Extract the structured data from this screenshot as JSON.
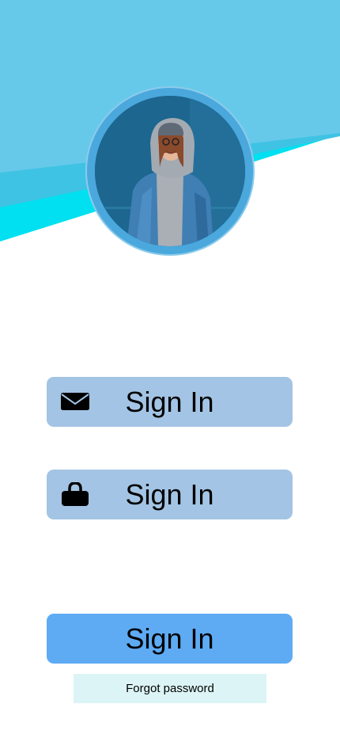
{
  "colors": {
    "header_primary": "#67c9ea",
    "header_accent": "#00e0f0",
    "avatar_ring": "#4aa8dd",
    "field_background": "#a3c4e4",
    "submit_background": "#5eabf4",
    "forgot_background": "#dcf4f5"
  },
  "avatar": {
    "description": "profile-photo"
  },
  "email_field": {
    "icon": "envelope-icon",
    "label": "Sign In"
  },
  "password_field": {
    "icon": "lock-icon",
    "label": "Sign In"
  },
  "submit_button": {
    "label": "Sign In"
  },
  "forgot_link": {
    "label": "Forgot password"
  }
}
